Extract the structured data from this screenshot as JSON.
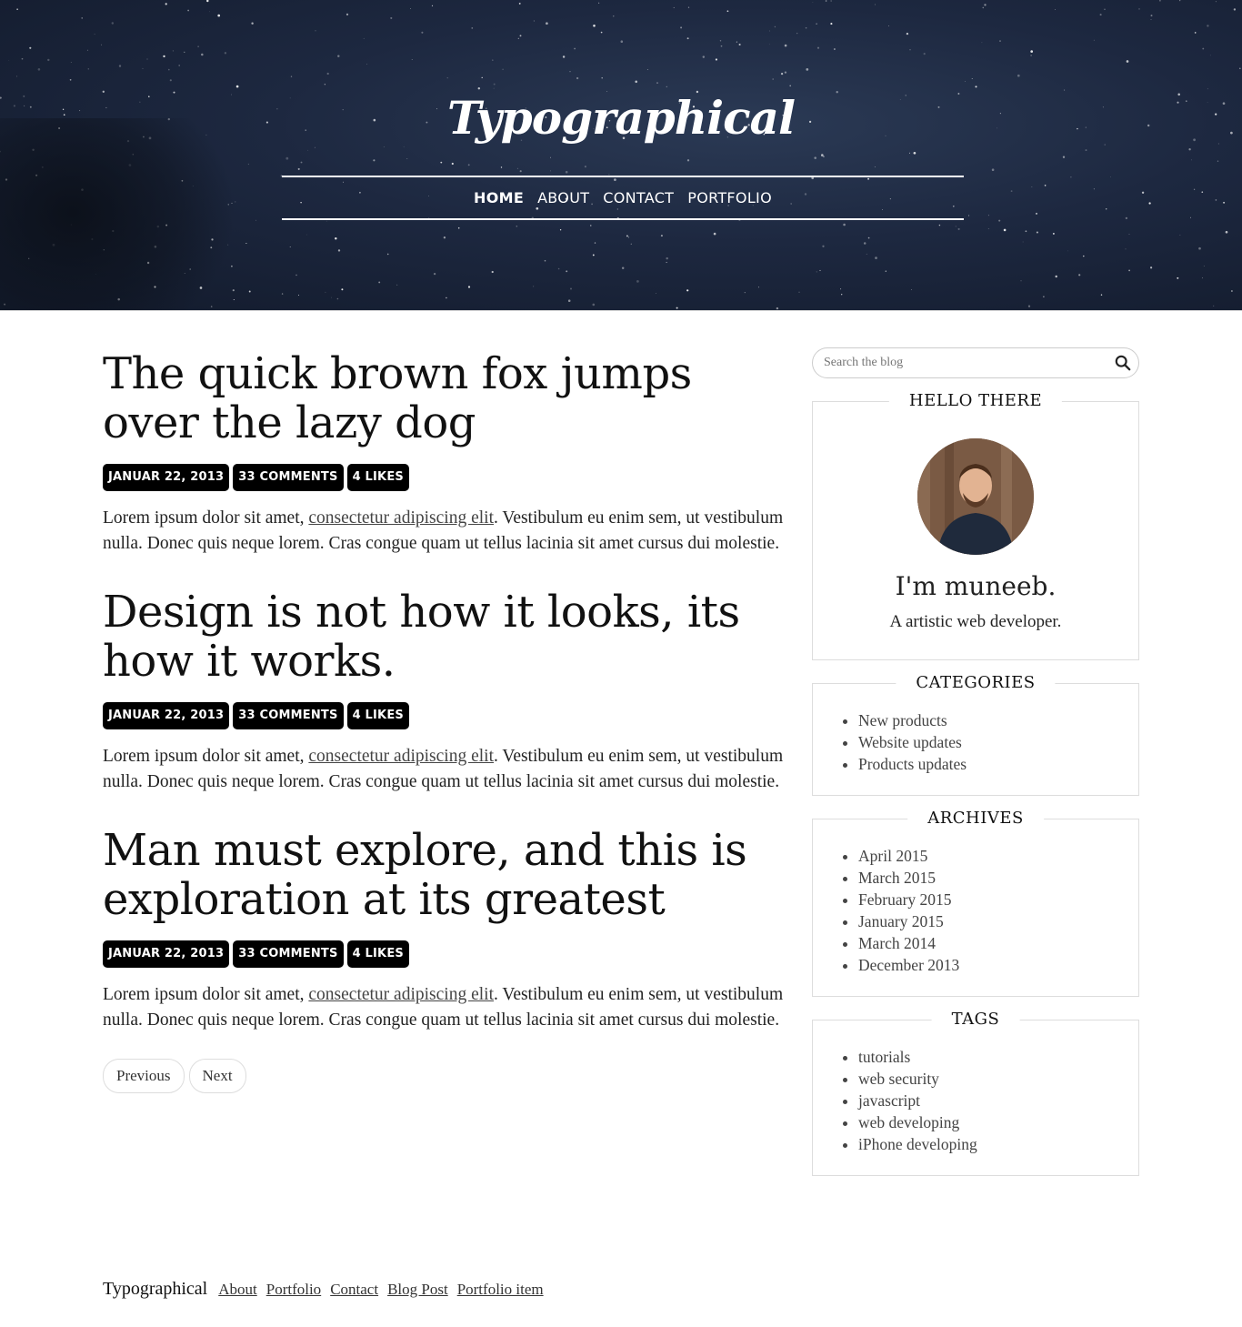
{
  "header": {
    "logo": "Typographical",
    "nav": [
      {
        "label": "HOME",
        "active": true
      },
      {
        "label": "ABOUT",
        "active": false
      },
      {
        "label": "CONTACT",
        "active": false
      },
      {
        "label": "PORTFOLIO",
        "active": false
      }
    ]
  },
  "posts": [
    {
      "title": "The quick brown fox jumps over the lazy dog",
      "date": "JANUAR 22, 2013",
      "comments": "33 COMMENTS",
      "likes": "4 LIKES",
      "text_before": "Lorem ipsum dolor sit amet, ",
      "link": "consectetur adipiscing elit",
      "text_after": ". Vestibulum eu enim sem, ut vestibulum nulla. Donec quis neque lorem. Cras congue quam ut tellus lacinia sit amet cursus dui molestie."
    },
    {
      "title": "Design is not how it looks, its how it works.",
      "date": "JANUAR 22, 2013",
      "comments": "33 COMMENTS",
      "likes": "4 LIKES",
      "text_before": "Lorem ipsum dolor sit amet, ",
      "link": "consectetur adipiscing elit",
      "text_after": ". Vestibulum eu enim sem, ut vestibulum nulla. Donec quis neque lorem. Cras congue quam ut tellus lacinia sit amet cursus dui molestie."
    },
    {
      "title": "Man must explore, and this is exploration at its greatest",
      "date": "JANUAR 22, 2013",
      "comments": "33 COMMENTS",
      "likes": "4 LIKES",
      "text_before": "Lorem ipsum dolor sit amet, ",
      "link": "consectetur adipiscing elit",
      "text_after": ". Vestibulum eu enim sem, ut vestibulum nulla. Donec quis neque lorem. Cras congue quam ut tellus lacinia sit amet cursus dui molestie."
    }
  ],
  "pager": {
    "previous": "Previous",
    "next": "Next"
  },
  "sidebar": {
    "search_placeholder": "Search the blog",
    "hello": {
      "title": "HELLO THERE",
      "name": "I'm muneeb.",
      "bio": "A artistic web developer."
    },
    "categories": {
      "title": "CATEGORIES",
      "items": [
        "New products",
        "Website updates",
        "Products updates"
      ]
    },
    "archives": {
      "title": "ARCHIVES",
      "items": [
        "April 2015",
        "March 2015",
        "February 2015",
        "January 2015",
        "March 2014",
        "December 2013"
      ]
    },
    "tags": {
      "title": "TAGS",
      "items": [
        "tutorials",
        "web security",
        "javascript",
        "web developing",
        "iPhone developing"
      ]
    }
  },
  "footer": {
    "brand": "Typographical",
    "links": [
      "About",
      "Portfolio",
      "Contact",
      "Blog Post",
      "Portfolio item"
    ]
  },
  "colors": {
    "hero_bg": "#1d2840",
    "tag_bg": "#000000",
    "border": "#dddddd"
  }
}
